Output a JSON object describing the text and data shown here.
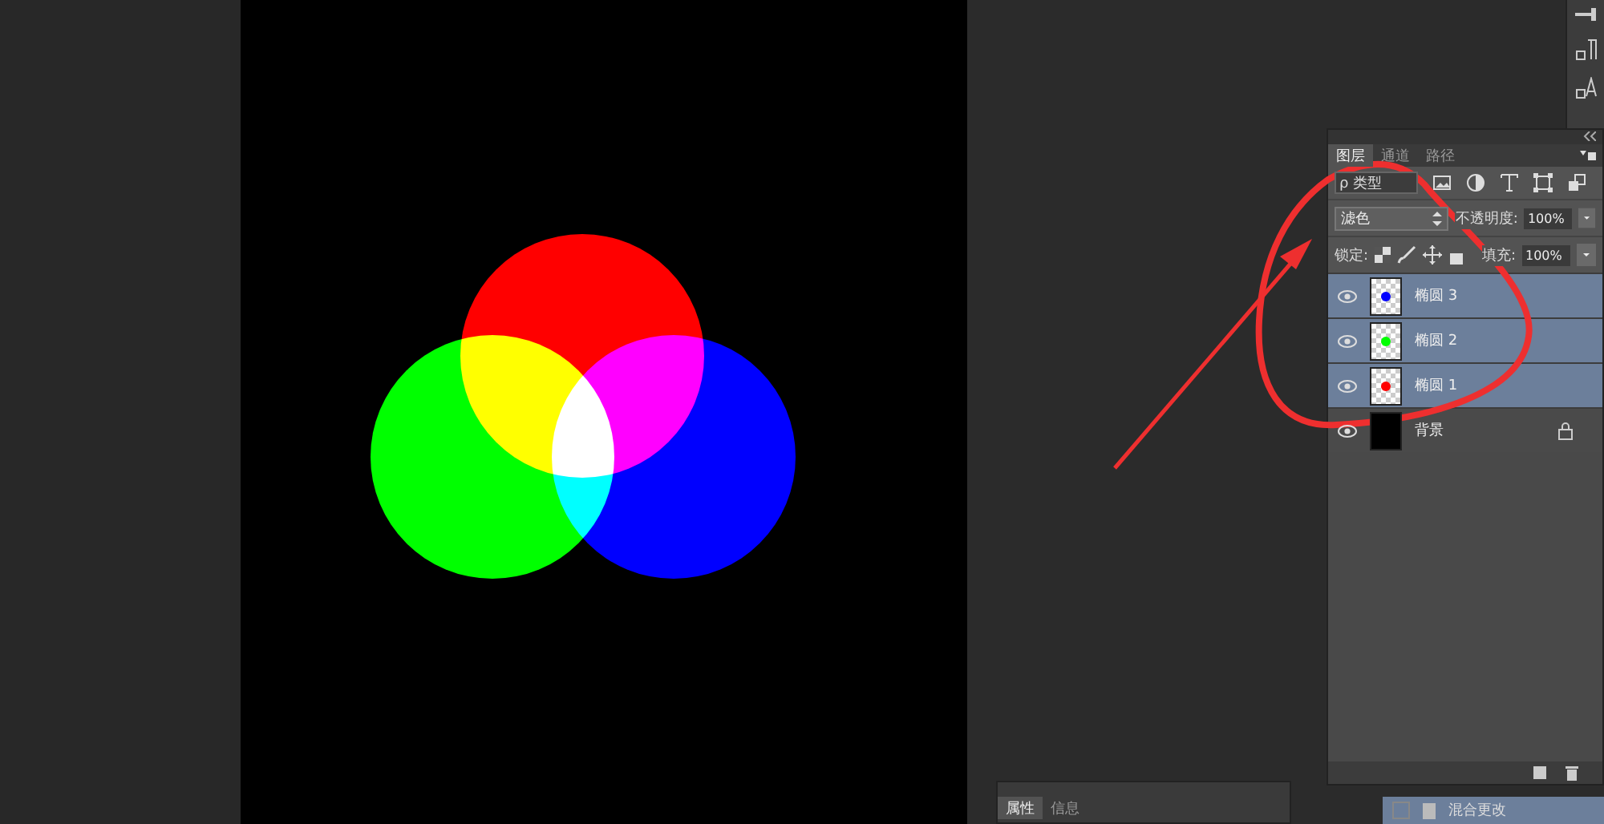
{
  "layers_panel": {
    "tabs": [
      {
        "label": "图层",
        "selected": true
      },
      {
        "label": "通道",
        "selected": false
      },
      {
        "label": "路径",
        "selected": false
      }
    ],
    "filter": {
      "icon": "ρ",
      "label": "类型"
    },
    "blend_mode": "滤色",
    "opacity_label": "不透明度:",
    "opacity": "100%",
    "lock_label": "锁定:",
    "fill_label": "填充:",
    "fill": "100%",
    "layers": [
      {
        "name": "椭圆 3",
        "selected": true,
        "color": "#0000ff",
        "kind": "shape"
      },
      {
        "name": "椭圆 2",
        "selected": true,
        "color": "#00ff00",
        "kind": "shape"
      },
      {
        "name": "椭圆 1",
        "selected": true,
        "color": "#ff0000",
        "kind": "shape"
      },
      {
        "name": "背景",
        "selected": false,
        "color": "#000000",
        "kind": "background"
      }
    ]
  },
  "properties_panel": {
    "tabs": [
      {
        "label": "属性",
        "selected": true
      },
      {
        "label": "信息",
        "selected": false
      }
    ]
  },
  "history_panel": {
    "items": [
      {
        "label": "混合更改",
        "selected": true
      }
    ]
  }
}
